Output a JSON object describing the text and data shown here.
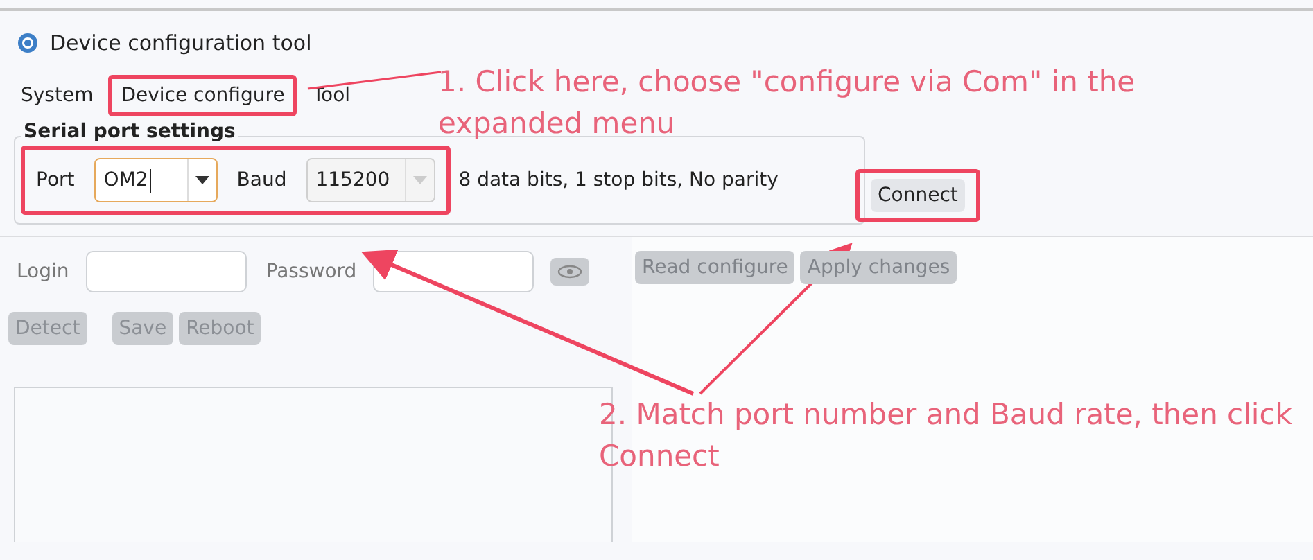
{
  "window": {
    "title": "Device configuration tool"
  },
  "menu": [
    {
      "label": "System",
      "highlighted": false
    },
    {
      "label": "Device configure",
      "highlighted": true
    },
    {
      "label": "Tool",
      "highlighted": false
    }
  ],
  "serial_settings": {
    "title": "Serial port settings",
    "port_label": "Port",
    "port_value": "OM2",
    "baud_label": "Baud",
    "baud_value": "115200",
    "baud_disabled": true,
    "format": "8 data bits, 1 stop bits, No parity",
    "highlighted": true
  },
  "connect": {
    "label": "Connect",
    "highlighted": true
  },
  "login": {
    "login_label": "Login",
    "password_label": "Password"
  },
  "buttons": [
    {
      "label": "Detect",
      "disabled": true
    },
    {
      "label": "Save",
      "disabled": true
    },
    {
      "label": "Reboot",
      "disabled": true
    }
  ],
  "config_buttons": [
    {
      "label": "Read configure",
      "disabled": true
    },
    {
      "label": "Apply changes",
      "disabled": true
    }
  ],
  "annotations": [
    {
      "text": "1. Click here, choose \"configure via Com\" in the expanded menu"
    },
    {
      "text": "2. Match port number and Baud rate, then click Connect"
    }
  ]
}
